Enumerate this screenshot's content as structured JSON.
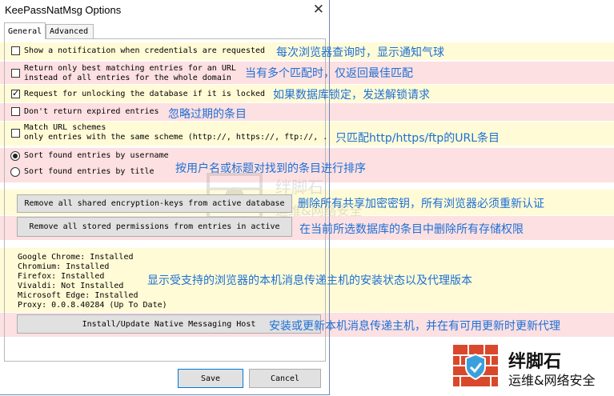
{
  "window": {
    "title": "KeePassNatMsg Options"
  },
  "tabs": [
    {
      "label": "General"
    },
    {
      "label": "Advanced"
    }
  ],
  "options": {
    "show_notification": {
      "label": "Show a notification when credentials are requested",
      "checked": false
    },
    "best_matching": {
      "line1": "Return only best matching entries for an URL",
      "line2": "instead of all entries for the whole domain",
      "checked": false
    },
    "request_unlock": {
      "label": "Request for unlocking the database if it is locked",
      "checked": true
    },
    "no_expired": {
      "label": "Don't return expired entries",
      "checked": false
    },
    "match_scheme": {
      "line1": "Match URL schemes",
      "line2": "only entries with the same scheme (http://, https://, ftp://, .",
      "checked": false
    },
    "sort_username": {
      "label": "Sort found entries by username",
      "selected": true
    },
    "sort_title": {
      "label": "Sort found entries by title",
      "selected": false
    }
  },
  "buttons": {
    "remove_keys": "Remove all shared encryption-keys from active database",
    "remove_permissions": "Remove all stored permissions from entries in active",
    "install_host": "Install/Update Native Messaging Host",
    "save": "Save",
    "cancel": "Cancel"
  },
  "status_lines": [
    "Google Chrome: Installed",
    "Chromium: Installed",
    "Firefox: Installed",
    "Vivaldi: Not Installed",
    "Microsoft Edge: Installed",
    "Proxy: 0.0.8.40284 (Up To Date)"
  ],
  "annotations": {
    "show_notification": "每次浏览器查询时，显示通知气球",
    "best_matching": "当有多个匹配时，仅返回最佳匹配",
    "request_unlock": "如果数据库锁定，发送解锁请求",
    "no_expired": "忽略过期的条目",
    "match_scheme": "只匹配http/https/ftp的URL条目",
    "sort": "按用户名或标题对找到的条目进行排序",
    "remove_keys": "删除所有共享加密密钥，所有浏览器必须重新认证",
    "remove_permissions": "在当前所选数据库的条目中删除所有存储权限",
    "status": "显示受支持的浏览器的本机消息传递主机的安装状态以及代理版本",
    "install_host": "安装或更新本机消息传递主机，并在有可用更新时更新代理"
  },
  "watermark": {
    "line1": "绊脚石",
    "line2": "运维&网络安全"
  },
  "logo": {
    "line1": "绊脚石",
    "line2": "运维&网络安全"
  },
  "colors": {
    "annotation_text": "#1d6fd6",
    "band_yellow": "#fffbd6",
    "band_pink": "#fde0e2",
    "logo_red": "#d9482b"
  }
}
